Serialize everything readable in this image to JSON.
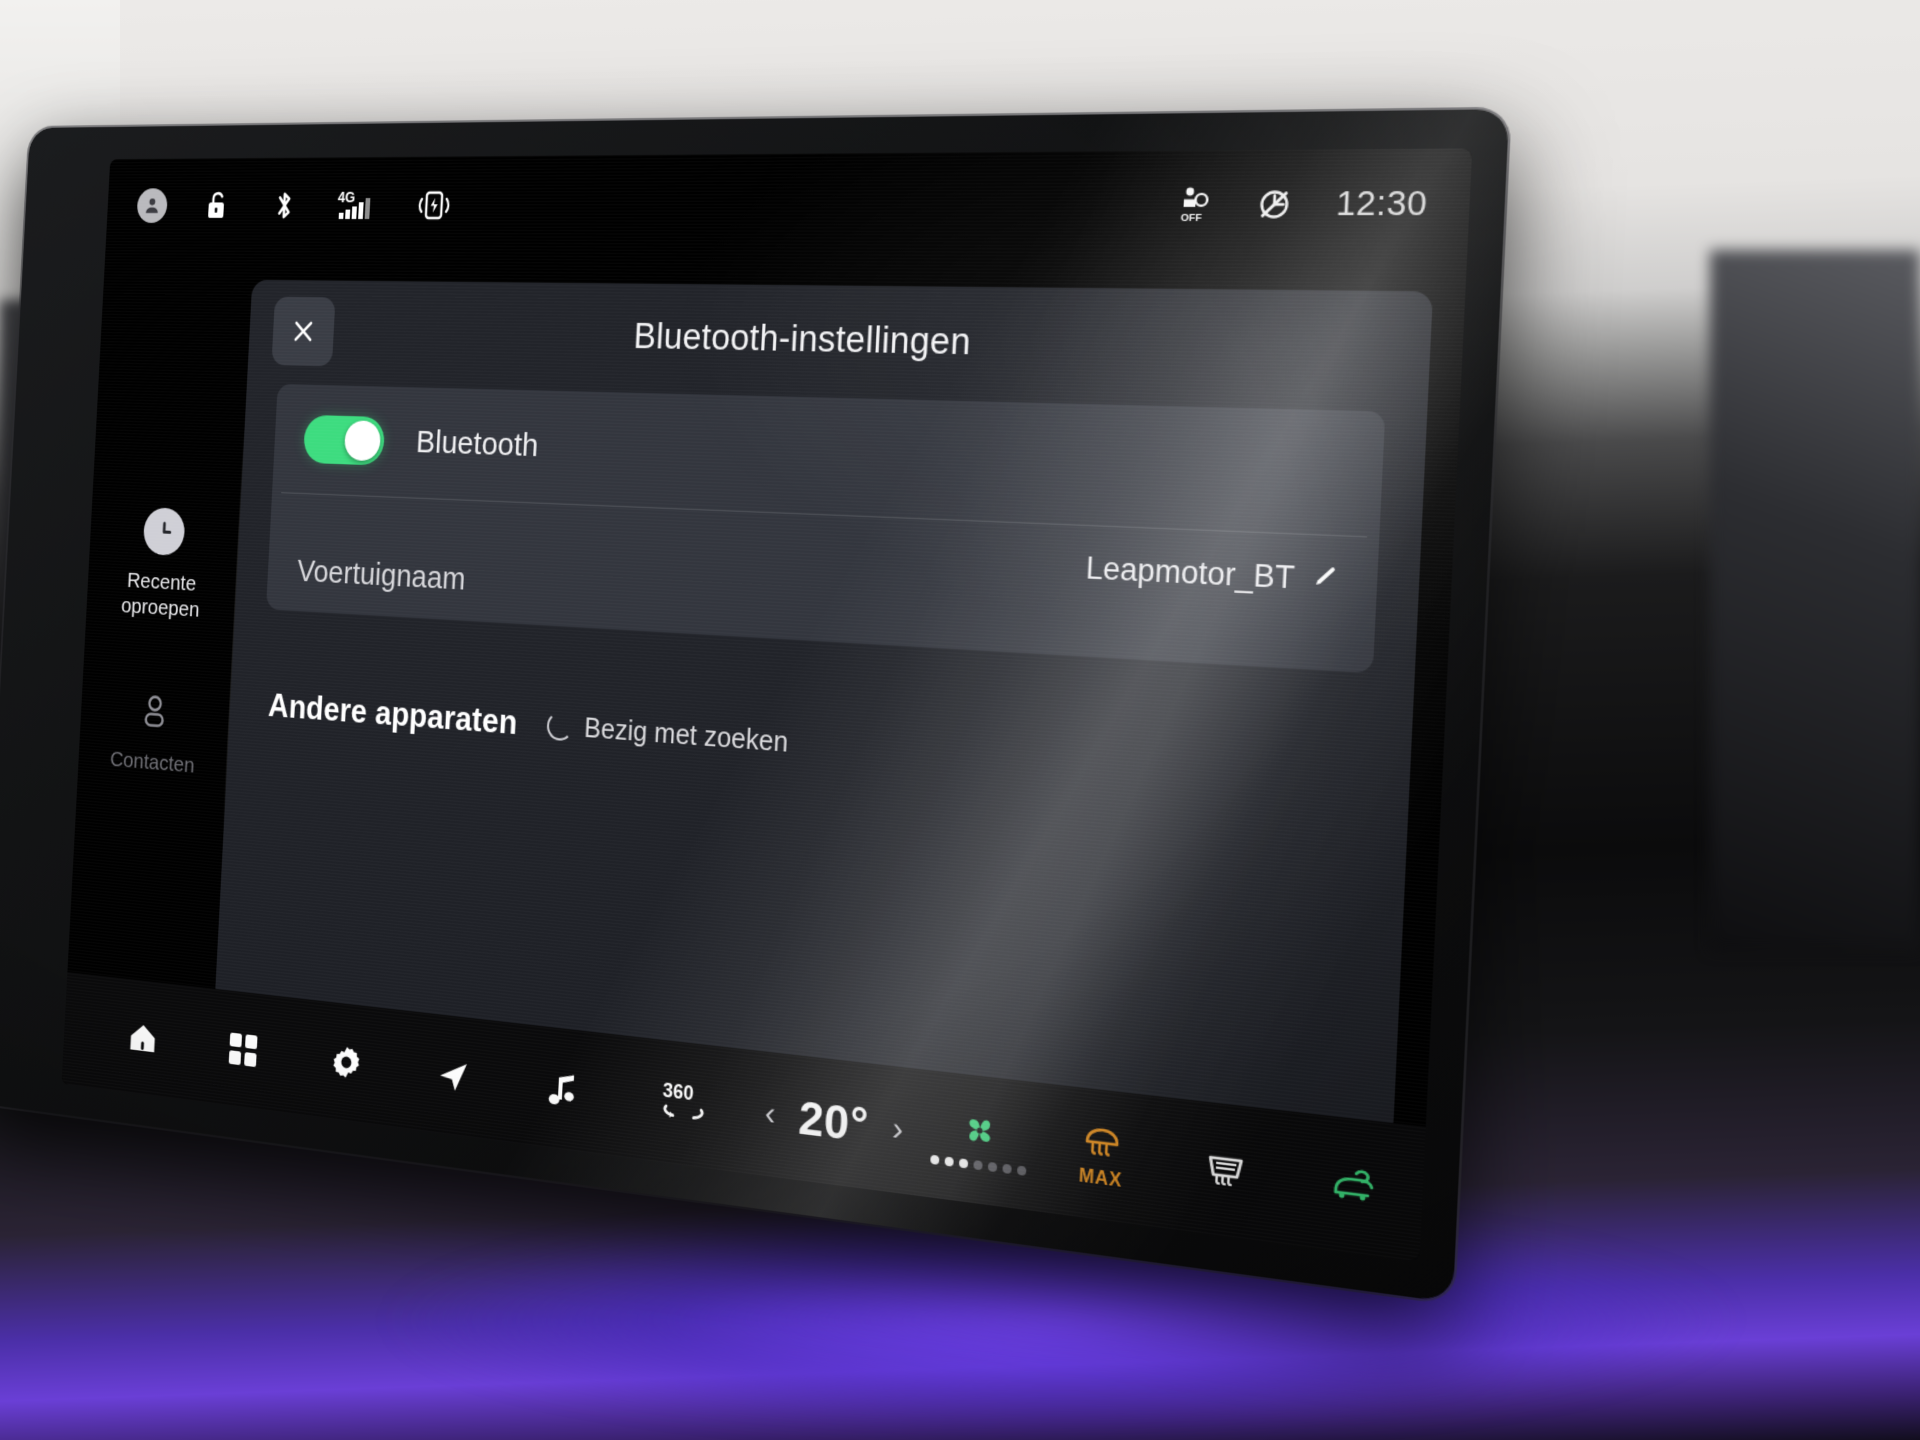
{
  "status_bar": {
    "icons_left": [
      {
        "name": "profile-icon",
        "label": "Profiel"
      },
      {
        "name": "unlock-icon",
        "label": "Ontgrendeld"
      },
      {
        "name": "bluetooth-icon",
        "label": "Bluetooth"
      },
      {
        "name": "signal-4g-icon",
        "label": "4G"
      },
      {
        "name": "wireless-charging-icon",
        "label": "Draadloos opladen"
      }
    ],
    "signal_label": "4G",
    "icons_right": [
      {
        "name": "airbag-off-icon",
        "label": "Airbag OFF"
      },
      {
        "name": "sound-off-icon",
        "label": "Geluid uit"
      }
    ],
    "airbag_label": "OFF",
    "time": "12:30"
  },
  "sidebar": {
    "items": [
      {
        "name": "recent-calls",
        "label": "Recente\noproepen",
        "label_line1": "Recente",
        "label_line2": "oproepen",
        "icon": "clock-icon",
        "selected": true
      },
      {
        "name": "contacts",
        "label": "Contacten",
        "icon": "person-icon",
        "selected": false
      }
    ]
  },
  "dialog": {
    "title": "Bluetooth-instellingen",
    "close_label": "✕",
    "bluetooth_row": {
      "label": "Bluetooth",
      "toggle_state": "on",
      "toggle_color": "#3ddc7f"
    },
    "vehicle_name_row": {
      "label": "Voertuignaam",
      "value": "Leapmotor_BT",
      "edit_icon": "pencil-icon"
    },
    "other_devices": {
      "title": "Andere apparaten",
      "status": "Bezig met zoeken",
      "spinner": "loading-spinner-icon"
    }
  },
  "bottom_bar": {
    "left_buttons": [
      {
        "name": "home-button",
        "icon": "home-icon"
      },
      {
        "name": "apps-button",
        "icon": "grid-apps-icon"
      },
      {
        "name": "settings-button",
        "icon": "gear-icon"
      },
      {
        "name": "navigation-button",
        "icon": "navigation-arrow-icon"
      },
      {
        "name": "media-button",
        "icon": "music-note-icon"
      },
      {
        "name": "camera-360-button",
        "icon": "camera-360-icon",
        "label": "360"
      }
    ],
    "climate": {
      "temp_down_label": "‹",
      "temperature": "20°",
      "temp_up_label": "›",
      "fan": {
        "icon": "fan-icon",
        "color": "#3ddc7f",
        "level": 3,
        "max_level": 7
      },
      "front_defrost": {
        "icon": "front-defrost-icon",
        "label": "MAX",
        "color": "#e8921f",
        "active": true
      },
      "rear_defrost": {
        "icon": "rear-defrost-icon",
        "color": "#ffffff",
        "active": false
      },
      "recirculation": {
        "icon": "air-recirculation-icon",
        "color": "#3ddc7f",
        "active": true
      },
      "airflow_mode": {
        "icon": "airflow-mode-icon",
        "color": "#ffffff",
        "active": false
      },
      "volume": {
        "icon": "volume-icon",
        "color": "#ffffff"
      }
    }
  },
  "theme": {
    "accent_green": "#3ddc7f",
    "accent_orange": "#e8921f",
    "screen_bg": "#000000",
    "dialog_bg": "#22242a",
    "card_bg": "#33363e"
  }
}
